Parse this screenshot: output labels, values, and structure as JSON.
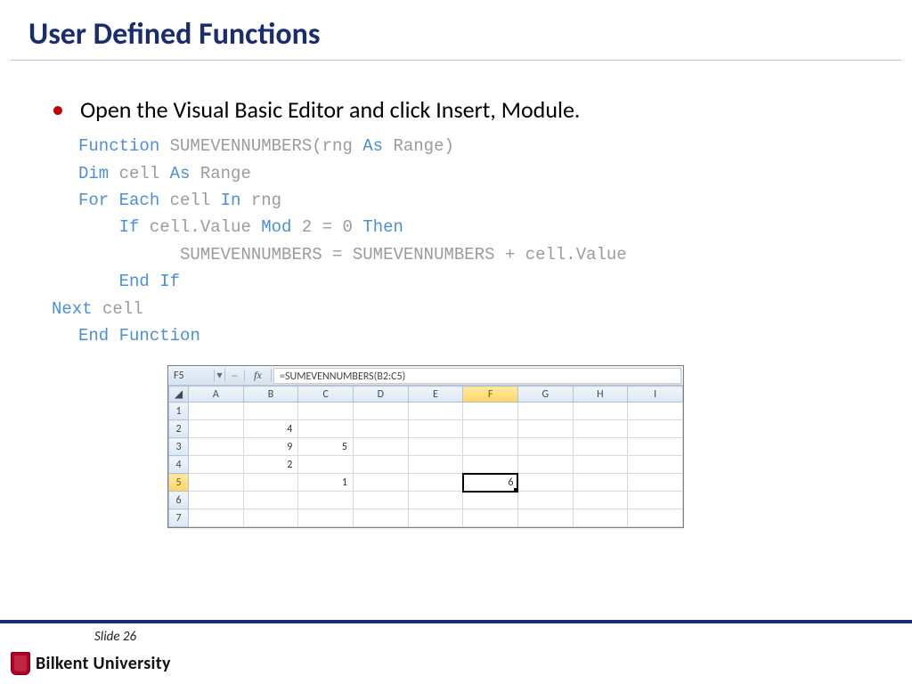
{
  "title": "User Defined Functions",
  "bullet": "Open the Visual Basic Editor and click Insert, Module.",
  "code": {
    "l1_kw1": "Function",
    "l1_txt": " SUMEVENNUMBERS(rng ",
    "l1_kw2": "As",
    "l1_txt2": " Range)",
    "l2_kw1": "Dim",
    "l2_txt": " cell ",
    "l2_kw2": "As",
    "l2_txt2": " Range",
    "l3_kw1": "For",
    "l3_kw2": "Each",
    "l3_txt": " cell ",
    "l3_kw3": "In",
    "l3_txt2": " rng",
    "l4_kw1": "If",
    "l4_txt": " cell.Value ",
    "l4_kw2": "Mod",
    "l4_txt2": " 2 = 0 ",
    "l4_kw3": "Then",
    "l5_txt": "SUMEVENNUMBERS = SUMEVENNUMBERS + cell.Value",
    "l6_kw1": "End",
    "l6_kw2": "If",
    "l7_kw1": "Next",
    "l7_txt": " cell",
    "l8_kw1": "End",
    "l8_kw2": "Function"
  },
  "excel": {
    "name_box": "F5",
    "fx_symbol": "fx",
    "formula": "=SUMEVENNUMBERS(B2:C5)",
    "cols": [
      "A",
      "B",
      "C",
      "D",
      "E",
      "F",
      "G",
      "H",
      "I"
    ],
    "rows": [
      "1",
      "2",
      "3",
      "4",
      "5",
      "6",
      "7"
    ],
    "B2": "4",
    "B3": "9",
    "C3": "5",
    "B4": "2",
    "C5": "1",
    "F5": "6"
  },
  "footer": {
    "slide_label": "Slide 26",
    "university": "Bilkent University"
  }
}
